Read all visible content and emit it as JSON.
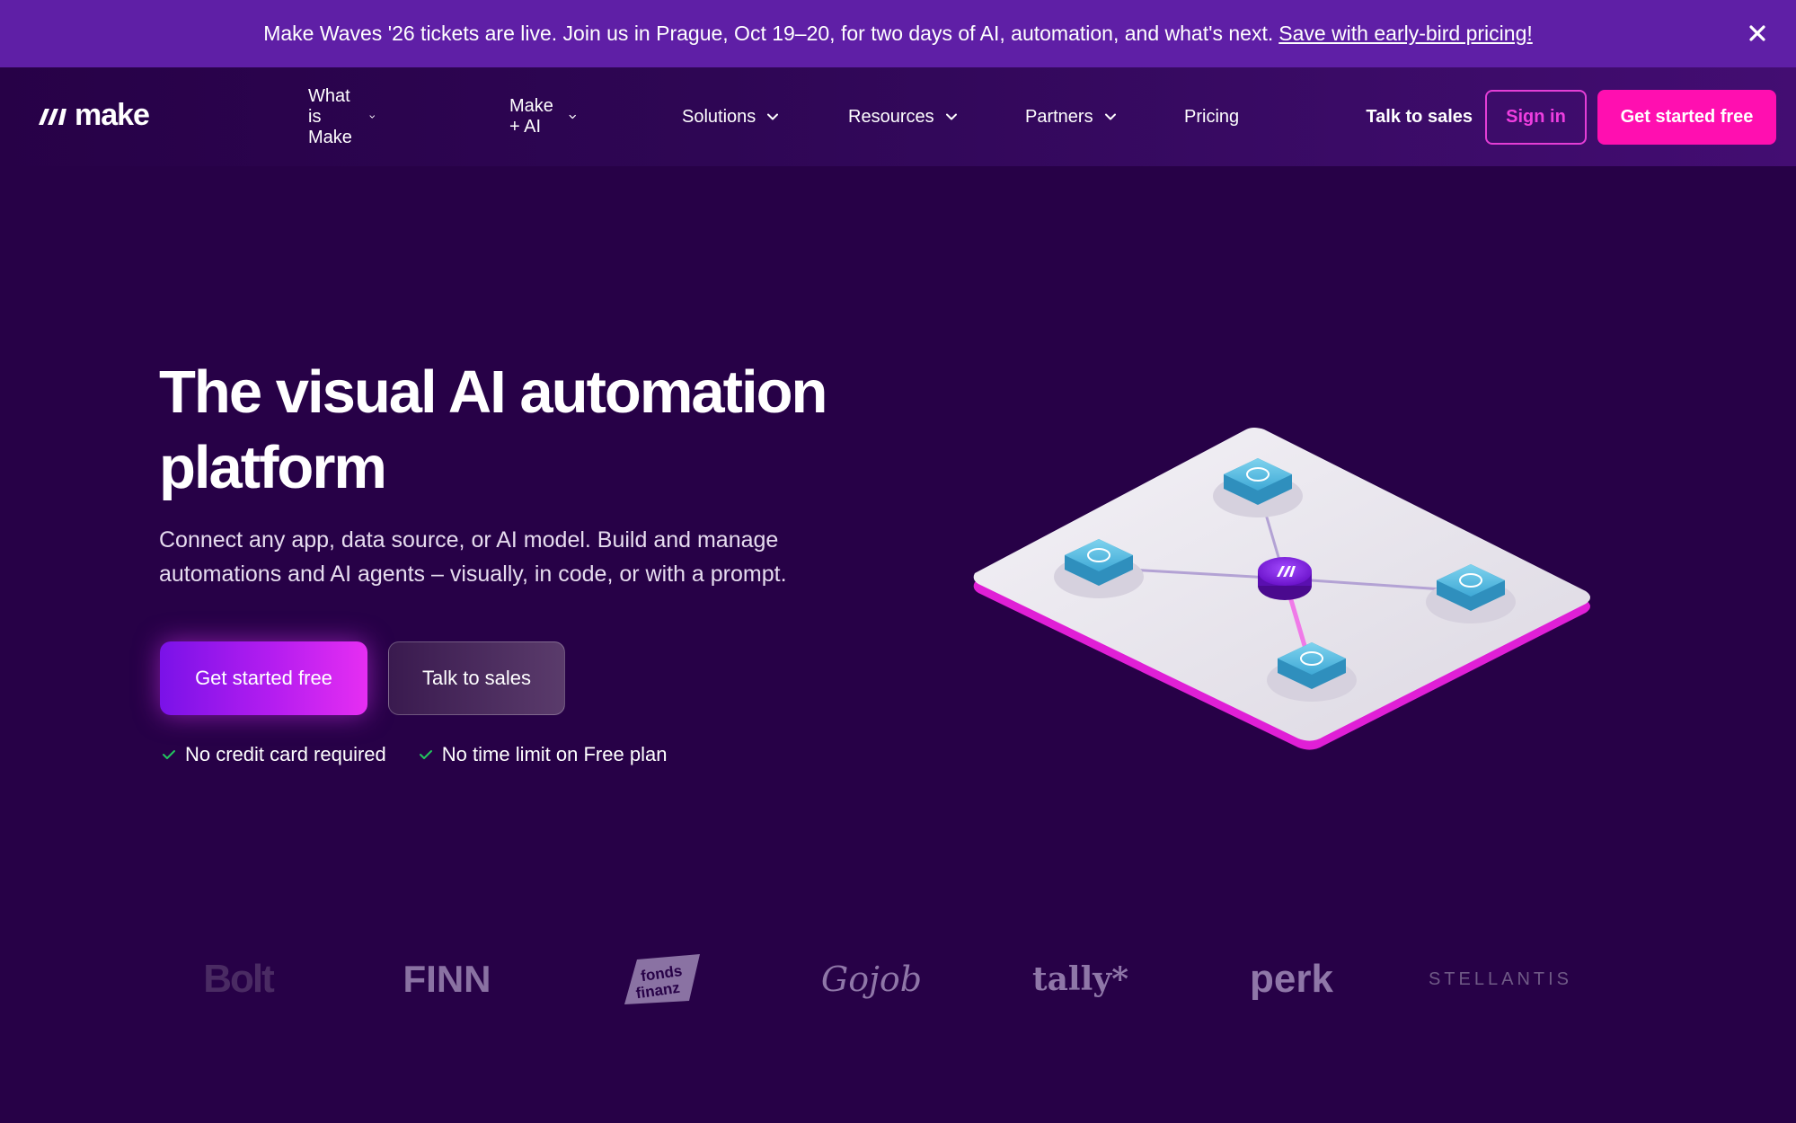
{
  "banner": {
    "message": "Make Waves '26 tickets are live. Join us in Prague, Oct 19–20, for two days of AI, automation, and what's next.",
    "link": "Save with early-bird pricing!",
    "close_icon": "close-icon"
  },
  "header": {
    "logo_text": "make",
    "nav": [
      {
        "label": "What is Make",
        "icon": "chevron-down-icon"
      },
      {
        "label": "Make + AI",
        "icon": "chevron-down-icon"
      },
      {
        "label": "Solutions",
        "icon": "chevron-down-icon"
      },
      {
        "label": "Resources",
        "icon": "chevron-down-icon"
      },
      {
        "label": "Partners",
        "icon": "chevron-down-icon"
      },
      {
        "label": "Pricing"
      }
    ],
    "talk_to_sales": "Talk to sales",
    "sign_in": "Sign in",
    "get_started": "Get started free"
  },
  "hero": {
    "title_line1": "The visual AI automation",
    "title_line2": "platform",
    "subtitle_line1": "Connect any app, data source, or AI model. Build and manage",
    "subtitle_line2": "automations and AI agents – visually, in code, or with a prompt.",
    "primary_cta": "Get started free",
    "secondary_cta": "Talk to sales",
    "checks": [
      "No credit card required",
      "No time limit on Free plan"
    ]
  },
  "logos": [
    "Bolt",
    "FINN",
    "fonds finanz",
    "Gojob",
    "tally*",
    "perk",
    "STELLANTIS"
  ],
  "colors": {
    "background": "#270147",
    "banner": "#5f1fa6",
    "accent_pink": "#ff0fb0",
    "sign_in_border": "#e43ed6",
    "check_green": "#22c55e"
  }
}
